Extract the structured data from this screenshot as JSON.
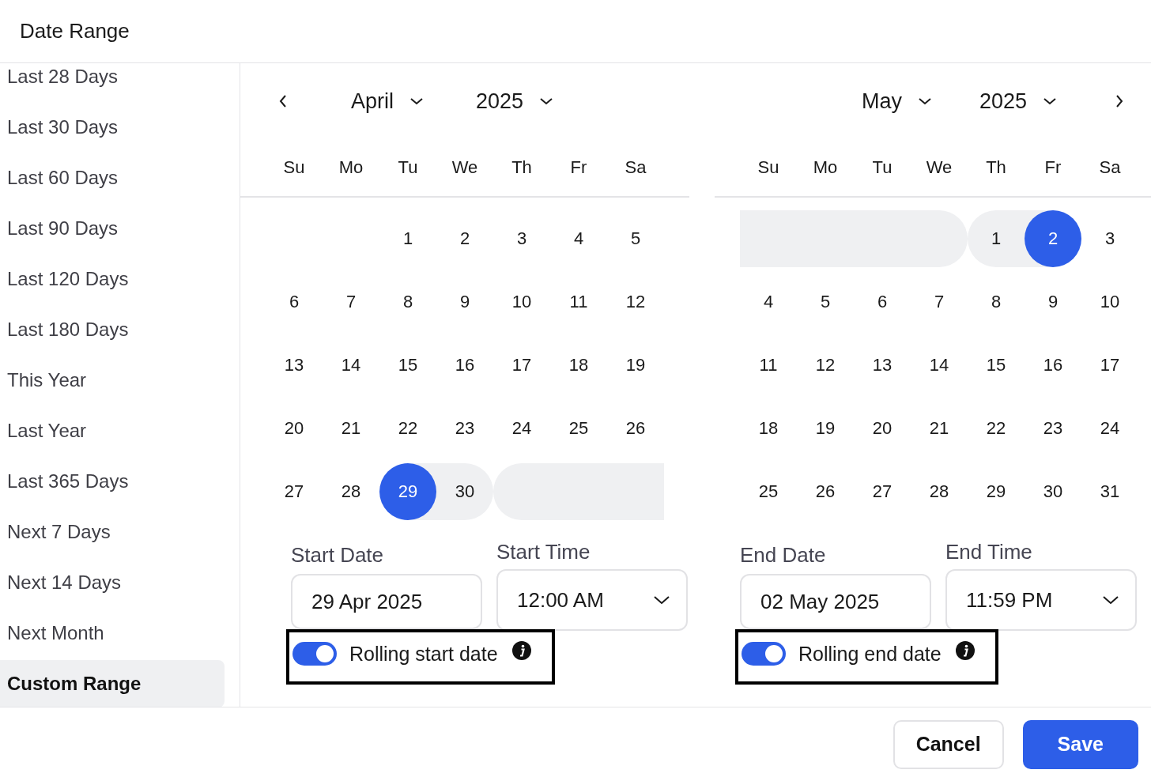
{
  "dialog": {
    "title": "Date Range"
  },
  "presets": [
    {
      "label": "Last 28 Days",
      "selected": false
    },
    {
      "label": "Last 30 Days",
      "selected": false
    },
    {
      "label": "Last 60 Days",
      "selected": false
    },
    {
      "label": "Last 90 Days",
      "selected": false
    },
    {
      "label": "Last 120 Days",
      "selected": false
    },
    {
      "label": "Last 180 Days",
      "selected": false
    },
    {
      "label": "This Year",
      "selected": false
    },
    {
      "label": "Last Year",
      "selected": false
    },
    {
      "label": "Last 365 Days",
      "selected": false
    },
    {
      "label": "Next 7 Days",
      "selected": false
    },
    {
      "label": "Next 14 Days",
      "selected": false
    },
    {
      "label": "Next Month",
      "selected": false
    },
    {
      "label": "Custom Range",
      "selected": true
    }
  ],
  "calendars": [
    {
      "prev_button": true,
      "next_button": false,
      "month": "April",
      "year": "2025",
      "weekdays": [
        "Su",
        "Mo",
        "Tu",
        "We",
        "Th",
        "Fr",
        "Sa"
      ],
      "weeks": [
        [
          {
            "in_range": false
          },
          {
            "in_range": false
          },
          {
            "day": "1",
            "selected": false,
            "in_range": false
          },
          {
            "day": "2",
            "selected": false,
            "in_range": false
          },
          {
            "day": "3",
            "selected": false,
            "in_range": false
          },
          {
            "day": "4",
            "selected": false,
            "in_range": false
          },
          {
            "day": "5",
            "selected": false,
            "in_range": false
          }
        ],
        [
          {
            "day": "6",
            "selected": false,
            "in_range": false
          },
          {
            "day": "7",
            "selected": false,
            "in_range": false
          },
          {
            "day": "8",
            "selected": false,
            "in_range": false
          },
          {
            "day": "9",
            "selected": false,
            "in_range": false
          },
          {
            "day": "10",
            "selected": false,
            "in_range": false
          },
          {
            "day": "11",
            "selected": false,
            "in_range": false
          },
          {
            "day": "12",
            "selected": false,
            "in_range": false
          }
        ],
        [
          {
            "day": "13",
            "selected": false,
            "in_range": false
          },
          {
            "day": "14",
            "selected": false,
            "in_range": false
          },
          {
            "day": "15",
            "selected": false,
            "in_range": false
          },
          {
            "day": "16",
            "selected": false,
            "in_range": false
          },
          {
            "day": "17",
            "selected": false,
            "in_range": false
          },
          {
            "day": "18",
            "selected": false,
            "in_range": false
          },
          {
            "day": "19",
            "selected": false,
            "in_range": false
          }
        ],
        [
          {
            "day": "20",
            "selected": false,
            "in_range": false
          },
          {
            "day": "21",
            "selected": false,
            "in_range": false
          },
          {
            "day": "22",
            "selected": false,
            "in_range": false
          },
          {
            "day": "23",
            "selected": false,
            "in_range": false
          },
          {
            "day": "24",
            "selected": false,
            "in_range": false
          },
          {
            "day": "25",
            "selected": false,
            "in_range": false
          },
          {
            "day": "26",
            "selected": false,
            "in_range": false
          }
        ],
        [
          {
            "day": "27",
            "selected": false,
            "in_range": false
          },
          {
            "day": "28",
            "selected": false,
            "in_range": false
          },
          {
            "day": "29",
            "selected": true,
            "in_range": true
          },
          {
            "day": "30",
            "selected": false,
            "in_range": true
          },
          {
            "in_range": true
          },
          {
            "in_range": true
          },
          {
            "in_range": true
          }
        ]
      ],
      "date_label": "Start Date",
      "date_value": "29 Apr 2025",
      "time_label": "Start Time",
      "time_value": "12:00 AM",
      "rolling": {
        "label": "Rolling start date",
        "on": true
      }
    },
    {
      "prev_button": false,
      "next_button": true,
      "month": "May",
      "year": "2025",
      "weekdays": [
        "Su",
        "Mo",
        "Tu",
        "We",
        "Th",
        "Fr",
        "Sa"
      ],
      "weeks": [
        [
          {
            "in_range": true
          },
          {
            "in_range": true
          },
          {
            "in_range": true
          },
          {
            "in_range": true
          },
          {
            "day": "1",
            "selected": false,
            "in_range": true
          },
          {
            "day": "2",
            "selected": true,
            "in_range": true
          },
          {
            "day": "3",
            "selected": false,
            "in_range": false
          }
        ],
        [
          {
            "day": "4",
            "selected": false,
            "in_range": false
          },
          {
            "day": "5",
            "selected": false,
            "in_range": false
          },
          {
            "day": "6",
            "selected": false,
            "in_range": false
          },
          {
            "day": "7",
            "selected": false,
            "in_range": false
          },
          {
            "day": "8",
            "selected": false,
            "in_range": false
          },
          {
            "day": "9",
            "selected": false,
            "in_range": false
          },
          {
            "day": "10",
            "selected": false,
            "in_range": false
          }
        ],
        [
          {
            "day": "11",
            "selected": false,
            "in_range": false
          },
          {
            "day": "12",
            "selected": false,
            "in_range": false
          },
          {
            "day": "13",
            "selected": false,
            "in_range": false
          },
          {
            "day": "14",
            "selected": false,
            "in_range": false
          },
          {
            "day": "15",
            "selected": false,
            "in_range": false
          },
          {
            "day": "16",
            "selected": false,
            "in_range": false
          },
          {
            "day": "17",
            "selected": false,
            "in_range": false
          }
        ],
        [
          {
            "day": "18",
            "selected": false,
            "in_range": false
          },
          {
            "day": "19",
            "selected": false,
            "in_range": false
          },
          {
            "day": "20",
            "selected": false,
            "in_range": false
          },
          {
            "day": "21",
            "selected": false,
            "in_range": false
          },
          {
            "day": "22",
            "selected": false,
            "in_range": false
          },
          {
            "day": "23",
            "selected": false,
            "in_range": false
          },
          {
            "day": "24",
            "selected": false,
            "in_range": false
          }
        ],
        [
          {
            "day": "25",
            "selected": false,
            "in_range": false
          },
          {
            "day": "26",
            "selected": false,
            "in_range": false
          },
          {
            "day": "27",
            "selected": false,
            "in_range": false
          },
          {
            "day": "28",
            "selected": false,
            "in_range": false
          },
          {
            "day": "29",
            "selected": false,
            "in_range": false
          },
          {
            "day": "30",
            "selected": false,
            "in_range": false
          },
          {
            "day": "31",
            "selected": false,
            "in_range": false
          }
        ]
      ],
      "date_label": "End Date",
      "date_value": "02 May 2025",
      "time_label": "End Time",
      "time_value": "11:59 PM",
      "rolling": {
        "label": "Rolling end date",
        "on": true
      }
    }
  ],
  "buttons": [
    {
      "label": "Cancel",
      "kind": "secondary"
    },
    {
      "label": "Save",
      "kind": "primary"
    }
  ]
}
